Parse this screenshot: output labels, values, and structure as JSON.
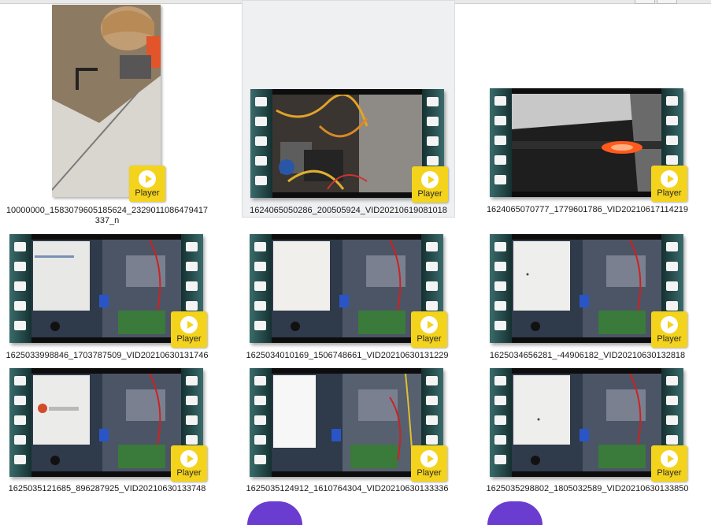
{
  "tiles": [
    {
      "caption": "10000000_1583079605185624_2329011086479417337_n",
      "player_label": "Player"
    },
    {
      "caption": "1624065050286_200505924_VID20210619081018",
      "player_label": "Player"
    },
    {
      "caption": "1624065070777_1779601786_VID20210617114219",
      "player_label": "Player"
    },
    {
      "caption": "1625033998846_1703787509_VID20210630131746",
      "player_label": "Player"
    },
    {
      "caption": "1625034010169_1506748661_VID20210630131229",
      "player_label": "Player"
    },
    {
      "caption": "1625034656281_-44906182_VID20210630132818",
      "player_label": "Player"
    },
    {
      "caption": "1625035121685_896287925_VID20210630133748",
      "player_label": "Player"
    },
    {
      "caption": "1625035124912_1610764304_VID20210630133336",
      "player_label": "Player"
    },
    {
      "caption": "1625035298802_1805032589_VID20210630133850",
      "player_label": "Player"
    }
  ],
  "colors": {
    "player": "#f4d31c",
    "film": "#0d0d0d",
    "sprocket": "#3a6b6b",
    "selection": "#eef0f2",
    "accent_purple": "#6a3cd0"
  }
}
